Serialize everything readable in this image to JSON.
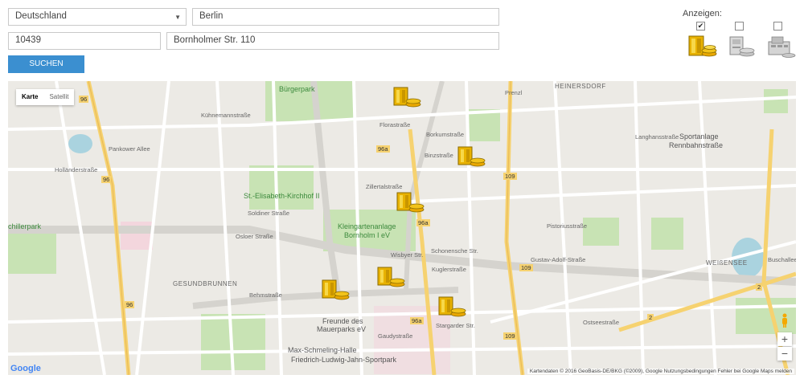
{
  "form": {
    "country": "Deutschland",
    "city": "Berlin",
    "zip": "10439",
    "street": "Bornholmer Str. 110",
    "search_label": "SUCHEN"
  },
  "filters": {
    "label": "Anzeigen:",
    "options": [
      {
        "icon": "atm-stack-icon",
        "checked": true
      },
      {
        "icon": "cash-machine-icon",
        "checked": false
      },
      {
        "icon": "cash-register-icon",
        "checked": false
      }
    ]
  },
  "map": {
    "type_map": "Karte",
    "type_satellite": "Satellit",
    "zoom_in": "+",
    "zoom_out": "−",
    "attribution": "Kartendaten © 2016 GeoBasis-DE/BKG (©2009), Google   Nutzungsbedingungen   Fehler bei Google Maps melden",
    "logo": "Google",
    "labels": {
      "buergerpark": "Bürgerpark",
      "heinersdorf": "HEINERSDORF",
      "sportanlage1": "Sportanlage",
      "sportanlage2": "Rennbahnstraße",
      "kirchhof": "St.-Elisabeth-Kirchhof II",
      "kleingarten1": "Kleingartenanlage",
      "kleingarten2": "Bornholm I eV",
      "gesundbrunnen": "GESUNDBRUNNEN",
      "mauerpark1": "Freunde des",
      "mauerpark2": "Mauerparks eV",
      "schmeling": "Max-Schmeling-Halle",
      "sportpark": "Friedrich-Ludwig-Jahn-Sportpark",
      "weissensee": "WEIßENSEE",
      "schillerpark": "chillerpark",
      "osloer": "Osloer Straße",
      "pankower": "Pankower Allee",
      "hollaender": "Holländerstraße",
      "borkum": "Borkumstraße",
      "binz": "Binzstraße",
      "zillertal": "Zillertalstraße",
      "floras": "Florastraße",
      "schonholzer": "Schonensche Str.",
      "kugler": "Kuglerstraße",
      "wisbyer": "Wisbyer Str.",
      "ostsee": "Ostseestraße",
      "buschallee": "Buschallee",
      "behm": "Behmstraße",
      "gaudy": "Gaudystraße",
      "stargarder": "Stargarder Str.",
      "lange": "Langhansstraße",
      "pistorius": "Pistoriusstraße",
      "gustav": "Gustav-Adolf-Straße",
      "kuellenborn": "Kühnemannstraße",
      "soldiner": "Soldiner Straße",
      "b96": "96",
      "b109": "109",
      "b96a": "96a",
      "b2": "2",
      "prenz": "Prenzl"
    }
  }
}
